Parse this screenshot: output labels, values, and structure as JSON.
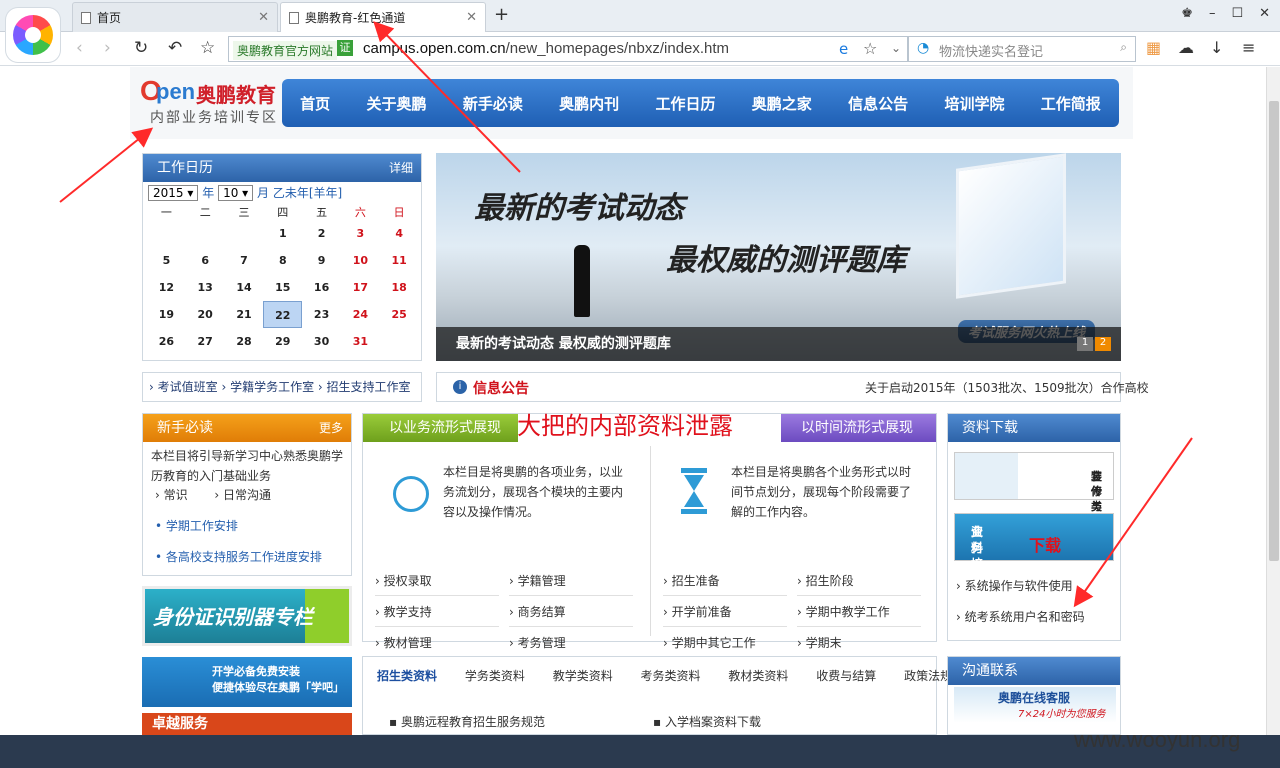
{
  "browser": {
    "tabs": [
      {
        "label": "首页",
        "active": false
      },
      {
        "label": "奥鹏教育-红色通道",
        "active": true
      }
    ],
    "address": {
      "site_badge": "奥鹏教育官方网站",
      "verified": "证",
      "url_domain": "campus.open.com.cn",
      "url_path": "/new_homepages/nbxz/index.htm"
    },
    "search": {
      "placeholder": "物流快递实名登记"
    }
  },
  "site": {
    "logo": {
      "name": "奥鹏教育",
      "subtitle": "内部业务培训专区"
    },
    "nav": [
      "首页",
      "关于奥鹏",
      "新手必读",
      "奥鹏内刊",
      "工作日历",
      "奥鹏之家",
      "信息公告",
      "培训学院",
      "工作简报"
    ],
    "calendar": {
      "title": "工作日历",
      "more": "详细",
      "year": "2015",
      "year_label": "年",
      "month": "10",
      "month_label": "月",
      "lunar": "乙未年[羊年]",
      "weekdays": [
        "一",
        "二",
        "三",
        "四",
        "五",
        "六",
        "日"
      ],
      "weeks": [
        [
          "",
          "",
          "",
          "1",
          "2",
          "3",
          "4"
        ],
        [
          "5",
          "6",
          "7",
          "8",
          "9",
          "10",
          "11"
        ],
        [
          "12",
          "13",
          "14",
          "15",
          "16",
          "17",
          "18"
        ],
        [
          "19",
          "20",
          "21",
          "22",
          "23",
          "24",
          "25"
        ],
        [
          "26",
          "27",
          "28",
          "29",
          "30",
          "31",
          ""
        ]
      ],
      "today": "22"
    },
    "banner": {
      "line1": "最新的考试动态",
      "line2": "最权威的测评题库",
      "caption": "最新的考试动态  最权威的测评题库",
      "badge": "考试服务网火热上线",
      "pages": [
        "1",
        "2"
      ]
    },
    "quick_links": [
      "考试值班室",
      "学籍学务工作室",
      "招生支持工作室"
    ],
    "notice": {
      "icon": "i",
      "label": "信息公告",
      "text": "关于启动2015年（1503批次、1509批次）合作高校"
    },
    "newbie": {
      "title": "新手必读",
      "more": "更多",
      "desc": "本栏目将引导新学习中心熟悉奥鹏学历教育的入门基础业务",
      "sub": [
        "常识",
        "日常沟通"
      ],
      "links": [
        "学期工作安排",
        "各高校支持服务工作进度安排"
      ]
    },
    "id_banner": "身份证识别器专栏",
    "ad1": [
      "开学必备免费安装",
      "便捷体验尽在奥鹏「学吧」"
    ],
    "ad2": "卓越服务",
    "biz": {
      "left_title": "以业务流形式展现",
      "right_title": "以时间流形式展现",
      "annotation": "大把的内部资料泄露",
      "left_desc": "本栏目是将奥鹏的各项业务，以业务流划分，展现各个模块的主要内容以及操作情况。",
      "right_desc": "本栏目是将奥鹏各个业务形式以时间节点划分，展现每个阶段需要了解的工作内容。",
      "left_items": [
        "授权录取",
        "学籍管理",
        "教学支持",
        "商务结算",
        "教材管理",
        "考务管理"
      ],
      "right_items": [
        "招生准备",
        "招生阶段",
        "开学前准备",
        "学期中教学工作",
        "学期中其它工作",
        "学期末"
      ]
    },
    "downloads": {
      "title": "资料下载",
      "banner1": [
        "装修与市场",
        "宣传类下载"
      ],
      "banner2": [
        "业务培训",
        "资料"
      ],
      "banner2_tag": "下载",
      "links": [
        "系统操作与软件使用",
        "统考系统用户名和密码"
      ]
    },
    "resources": {
      "tabs": [
        "招生类资料",
        "学务类资料",
        "教学类资料",
        "考务类资料",
        "教材类资料",
        "收费与结算",
        "政策法规"
      ],
      "active_tab": "招生类资料",
      "items": [
        "奥鹏远程教育招生服务规范",
        "入学档案资料下载"
      ]
    },
    "contact": {
      "title": "沟通联系",
      "service": "奥鹏在线客服",
      "hours": "7×24小时为您服务"
    }
  },
  "watermark": "www.wooyun.org",
  "colors": {
    "nav": "#2d6fc4",
    "accent_red": "#e0111c",
    "orange": "#f08a00",
    "green": "#8cc63f",
    "purple": "#7b5cd0"
  }
}
